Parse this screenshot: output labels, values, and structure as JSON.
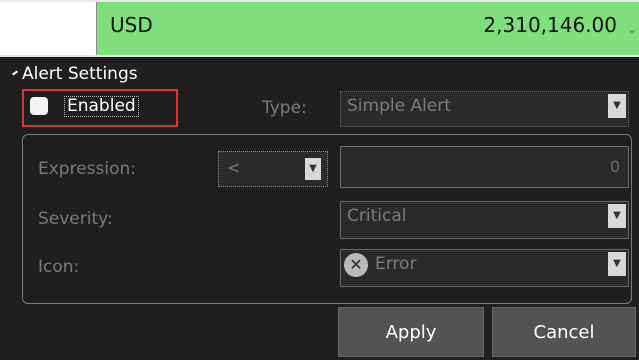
{
  "top_row": {
    "currency": "USD",
    "amount": "2,310,146.00"
  },
  "alert_settings": {
    "title": "Alert Settings",
    "enabled": {
      "label": "Enabled",
      "checked": false
    },
    "type": {
      "label": "Type:",
      "value": "Simple Alert"
    },
    "expression": {
      "label": "Expression:",
      "operator": "<",
      "value": "0"
    },
    "severity": {
      "label": "Severity:",
      "value": "Critical"
    },
    "icon": {
      "label": "Icon:",
      "value": "Error",
      "icon_name": "error-x-icon"
    }
  },
  "buttons": {
    "apply": "Apply",
    "cancel": "Cancel"
  },
  "colors": {
    "background": "#1f1f1f",
    "green_row": "#7fdf7c",
    "highlight": "#e03333"
  }
}
